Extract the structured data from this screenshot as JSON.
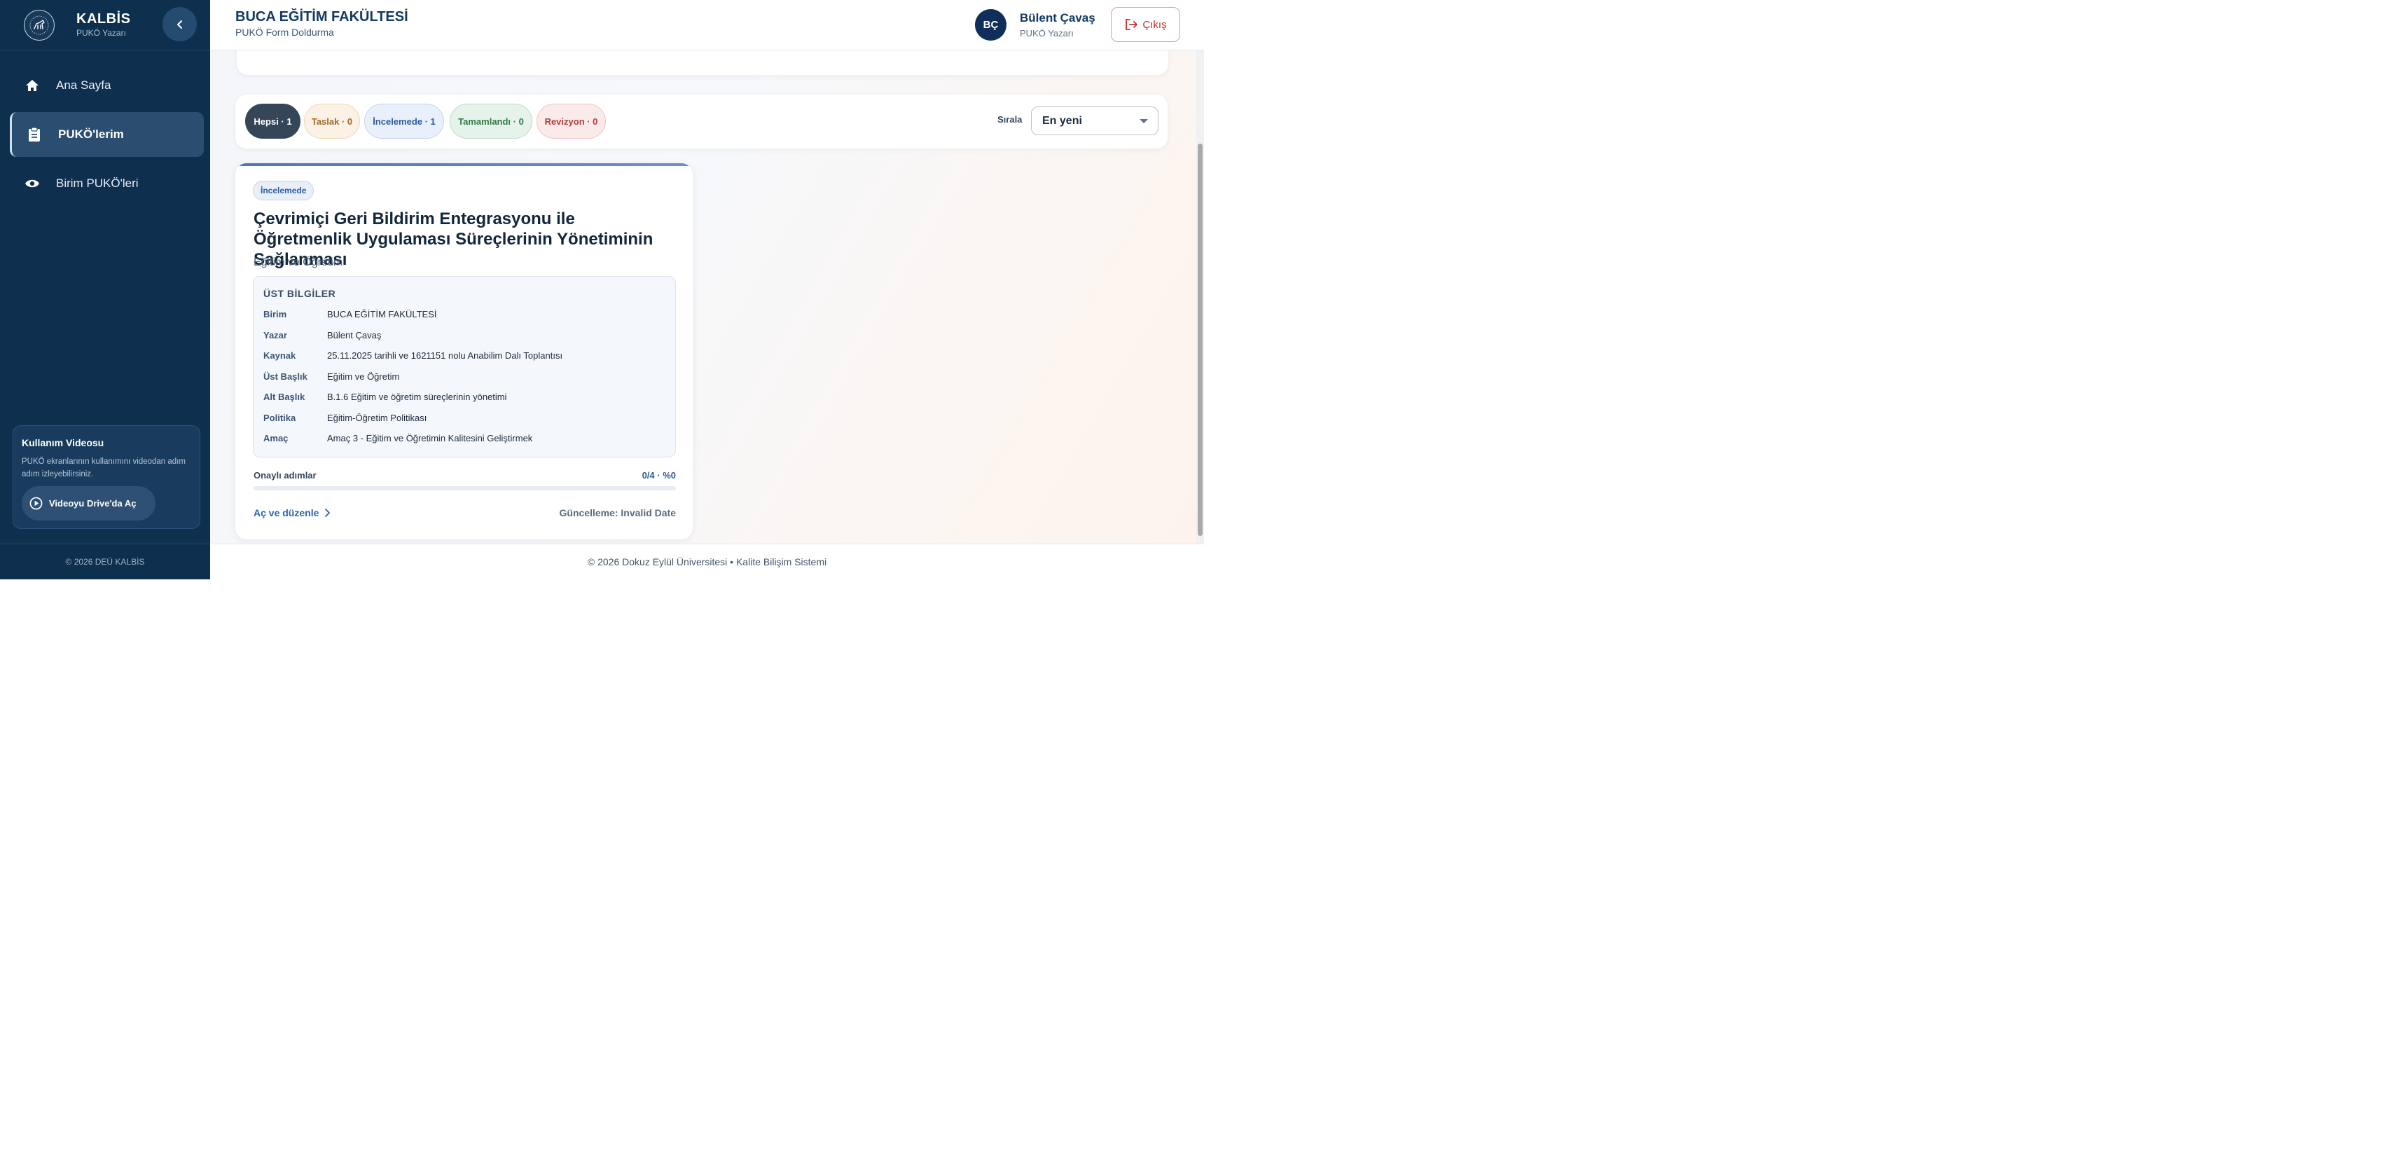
{
  "sidebar": {
    "brand_name": "KALBİS",
    "brand_sub": "PUKÖ Yazarı",
    "nav": [
      {
        "label": "Ana Sayfa",
        "icon": "home-icon",
        "active": false
      },
      {
        "label": "PUKÖ'lerim",
        "icon": "clipboard-icon",
        "active": true
      },
      {
        "label": "Birim PUKÖ'leri",
        "icon": "eye-icon",
        "active": false
      }
    ],
    "video_card": {
      "title": "Kullanım Videosu",
      "description": "PUKÖ ekranlarının kullanımını videodan adım adım izleyebilirsiniz.",
      "button_label": "Videoyu Drive'da Aç"
    },
    "footer": "© 2026 DEÜ KALBİS"
  },
  "header": {
    "title": "BUCA EĞİTİM FAKÜLTESİ",
    "subtitle": "PUKÖ Form Doldurma",
    "user": {
      "initials": "BÇ",
      "name": "Bülent Çavaş",
      "role": "PUKÖ Yazarı"
    },
    "logout_label": "Çıkış"
  },
  "filters": {
    "chips": [
      {
        "label": "Hepsi · 1",
        "active": true
      },
      {
        "label": "Taslak · 0",
        "active": false
      },
      {
        "label": "İncelemede · 1",
        "active": false
      },
      {
        "label": "Tamamlandı · 0",
        "active": false
      },
      {
        "label": "Revizyon · 0",
        "active": false
      }
    ],
    "sort_label": "Sırala",
    "sort_value": "En yeni"
  },
  "card": {
    "status": "İncelemede",
    "title": "Çevrimiçi Geri Bildirim Entegrasyonu ile Öğretmenlik Uygulaması Süreçlerinin Yönetiminin Sağlanması",
    "category": "Eğitim ve Öğretim",
    "meta_title": "ÜST BİLGİLER",
    "meta": [
      {
        "key": "Birim",
        "value": "BUCA EĞİTİM FAKÜLTESİ"
      },
      {
        "key": "Yazar",
        "value": "Bülent Çavaş"
      },
      {
        "key": "Kaynak",
        "value": "25.11.2025 tarihli ve 1621151 nolu Anabilim Dalı Toplantısı"
      },
      {
        "key": "Üst Başlık",
        "value": "Eğitim ve Öğretim"
      },
      {
        "key": "Alt Başlık",
        "value": "B.1.6 Eğitim ve öğretim süreçlerinin yönetimi"
      },
      {
        "key": "Politika",
        "value": "Eğitim-Öğretim Politikası"
      },
      {
        "key": "Amaç",
        "value": "Amaç 3 - Eğitim ve Öğretimin Kalitesini Geliştirmek"
      }
    ],
    "progress_label": "Onaylı adımlar",
    "progress_text": "0/4 · %0",
    "progress_fraction": 0,
    "open_label": "Aç ve düzenle",
    "updated_text": "Güncelleme: Invalid Date"
  },
  "footer": "© 2026 Dokuz Eylül Üniversitesi • Kalite Bilişim Sistemi",
  "colors": {
    "sidebar_bg": "#0f2f4e",
    "accent": "#2d5da0",
    "danger": "#c92e2e"
  }
}
